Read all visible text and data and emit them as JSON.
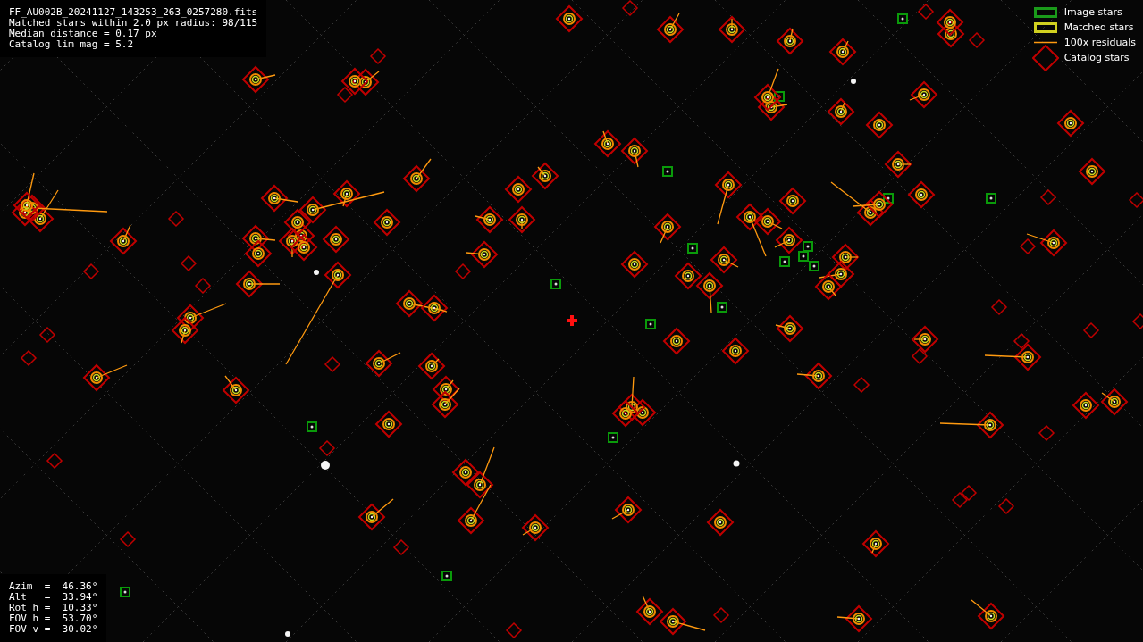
{
  "header": {
    "lines": [
      "FF_AU002B_20241127_143253_263_0257280.fits",
      "Matched stars within 2.0 px radius: 98/115",
      "Median distance = 0.17 px",
      "Catalog lim mag = 5.2"
    ]
  },
  "legend": {
    "items": [
      {
        "kind": "image",
        "label": "Image stars"
      },
      {
        "kind": "matched",
        "label": "Matched stars"
      },
      {
        "kind": "residual",
        "label": "100x residuals"
      },
      {
        "kind": "catalog",
        "label": "Catalog stars"
      }
    ]
  },
  "info": {
    "lines": [
      "Azim  =  46.36°",
      "Alt   =  33.94°",
      "Rot h =  10.33°",
      "FOV h =  53.70°",
      "FOV v =  30.02°"
    ]
  }
}
